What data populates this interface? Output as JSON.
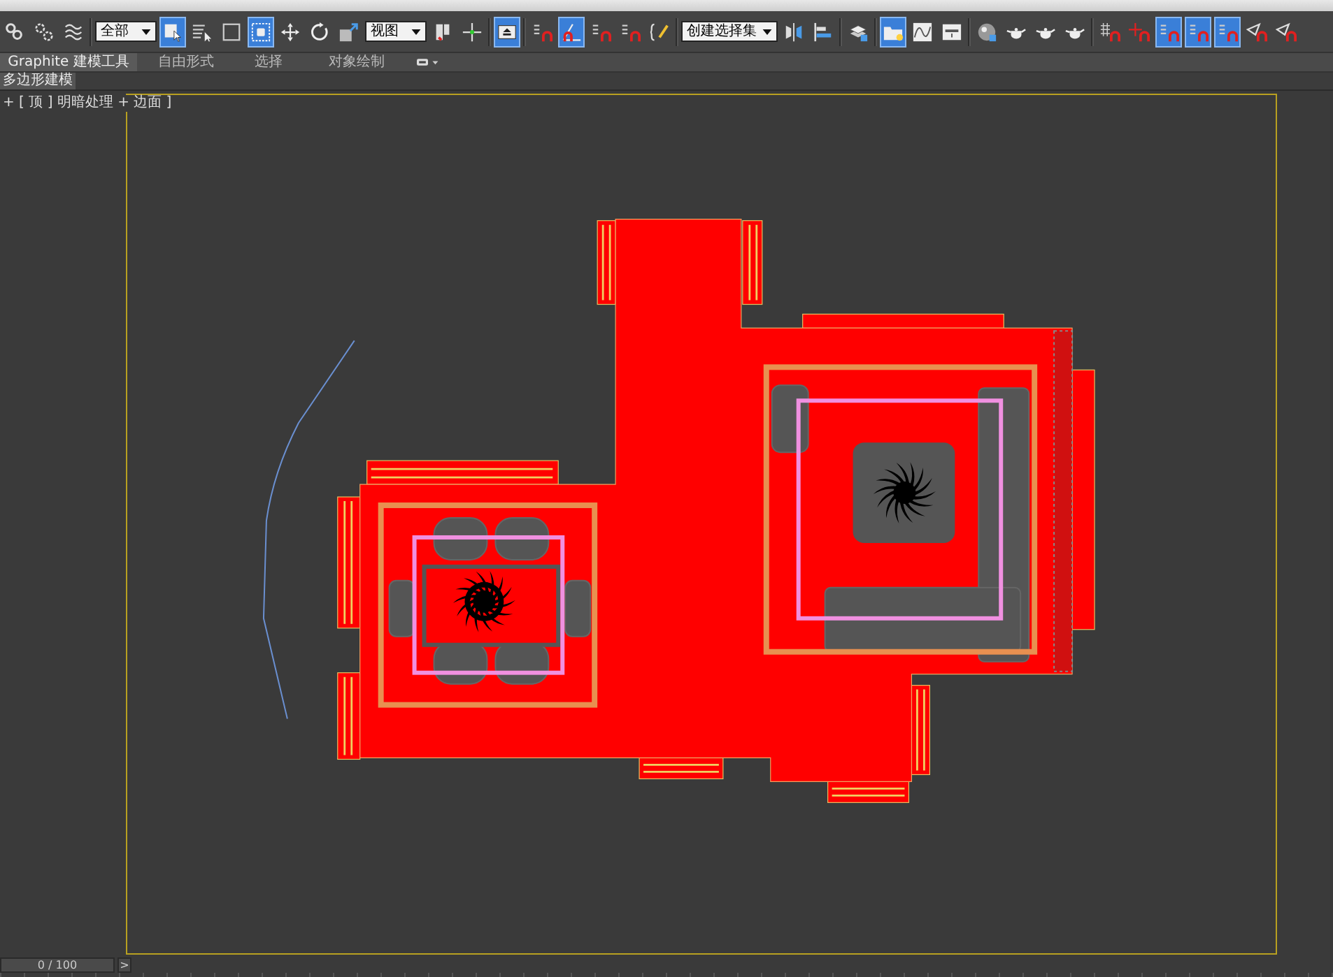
{
  "toolbar": [
    {
      "kind": "button",
      "on": false
    },
    {
      "kind": "button",
      "on": false
    },
    {
      "kind": "button",
      "on": false
    },
    {
      "kind": "dropdown",
      "value": "全部"
    },
    {
      "kind": "button",
      "on": true
    },
    {
      "kind": "button",
      "on": false
    },
    {
      "kind": "button",
      "on": false
    },
    {
      "kind": "button",
      "on": true
    },
    {
      "kind": "button",
      "on": false
    },
    {
      "kind": "button",
      "on": false
    },
    {
      "kind": "button",
      "on": false
    },
    {
      "kind": "dropdown",
      "value": "视图"
    },
    {
      "kind": "button",
      "on": false
    },
    {
      "kind": "button",
      "on": false
    },
    {
      "kind": "button",
      "on": true
    },
    {
      "kind": "button",
      "on": false
    },
    {
      "kind": "button",
      "on": true
    },
    {
      "kind": "button",
      "on": false
    },
    {
      "kind": "button",
      "on": false
    },
    {
      "kind": "button",
      "on": false
    },
    {
      "kind": "dropdown",
      "value": "创建选择集"
    },
    {
      "kind": "button",
      "on": false
    },
    {
      "kind": "button",
      "on": false
    },
    {
      "kind": "button",
      "on": false
    },
    {
      "kind": "button",
      "on": true
    },
    {
      "kind": "button",
      "on": false
    },
    {
      "kind": "button",
      "on": false
    },
    {
      "kind": "button",
      "on": false
    },
    {
      "kind": "button",
      "on": false
    },
    {
      "kind": "button",
      "on": false
    },
    {
      "kind": "button",
      "on": false
    },
    {
      "kind": "button",
      "on": false
    },
    {
      "kind": "button",
      "on": false
    },
    {
      "kind": "button",
      "on": true
    },
    {
      "kind": "button",
      "on": true
    },
    {
      "kind": "button",
      "on": true
    },
    {
      "kind": "button",
      "on": false
    },
    {
      "kind": "button",
      "on": false
    }
  ],
  "ribbon": {
    "tabs": [
      {
        "label": "Graphite 建模工具",
        "selected": true
      },
      {
        "label": "自由形式",
        "selected": false
      },
      {
        "label": "选择",
        "selected": false
      },
      {
        "label": "对象绘制",
        "selected": false
      }
    ],
    "panel_tab": "多边形建模"
  },
  "viewport": {
    "label": "+ [ 顶 ] 明暗处理 + 边面 ]"
  },
  "time_slider": {
    "reading": "0 / 100",
    "level": 0,
    "next": ">"
  }
}
